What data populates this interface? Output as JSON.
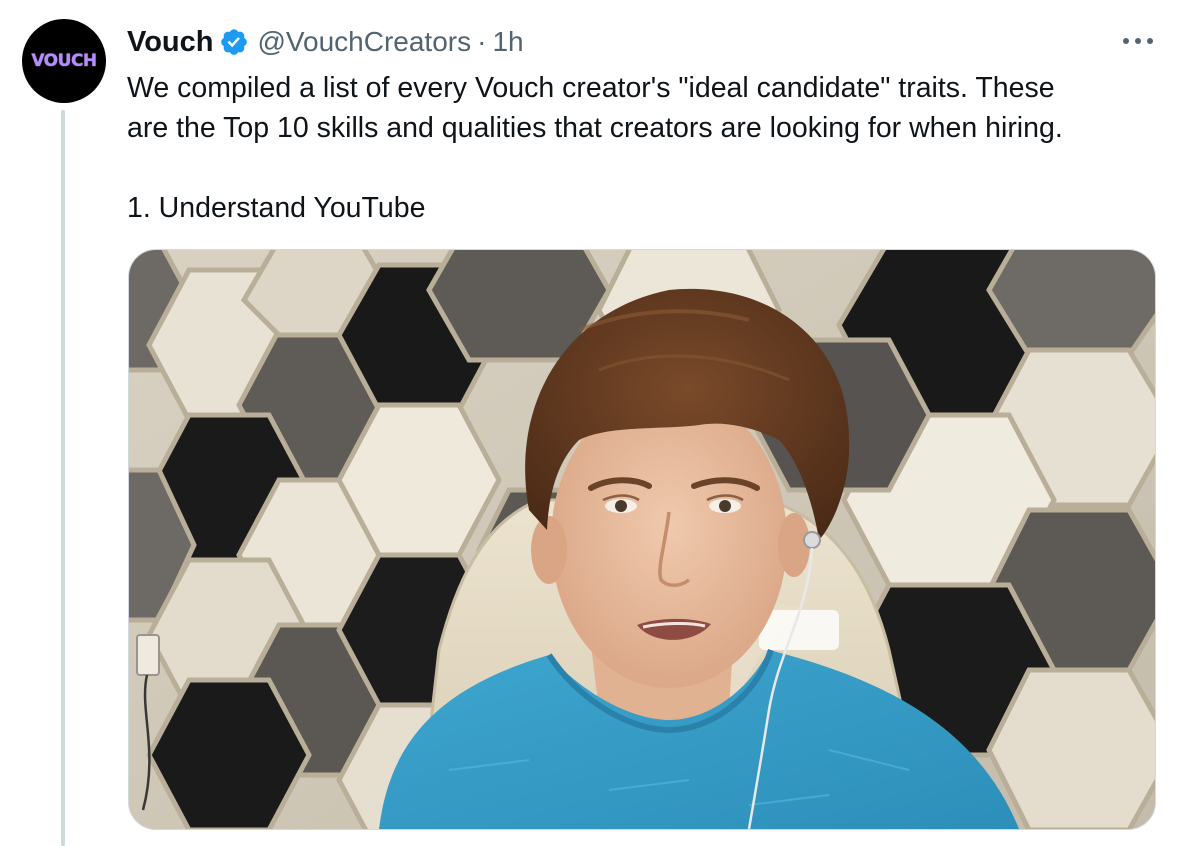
{
  "tweet": {
    "author": {
      "display_name": "Vouch",
      "handle": "@VouchCreators",
      "avatar_text": "VOUCH",
      "verified": true
    },
    "separator": "·",
    "timestamp": "1h",
    "more_icon": "more-horizontal-icon",
    "text_lines": [
      "We compiled a list of every Vouch creator's \"ideal candidate\" traits. These",
      "are the Top 10 skills and qualities that creators are looking for when hiring.",
      "1. Understand YouTube"
    ],
    "media": {
      "type": "video-thumbnail"
    }
  },
  "colors": {
    "text_primary": "#0f1419",
    "text_secondary": "#536471",
    "verified_blue": "#1d9bf0",
    "avatar_bg": "#000000",
    "avatar_text": "#b48cff",
    "border": "#cfd9de"
  }
}
